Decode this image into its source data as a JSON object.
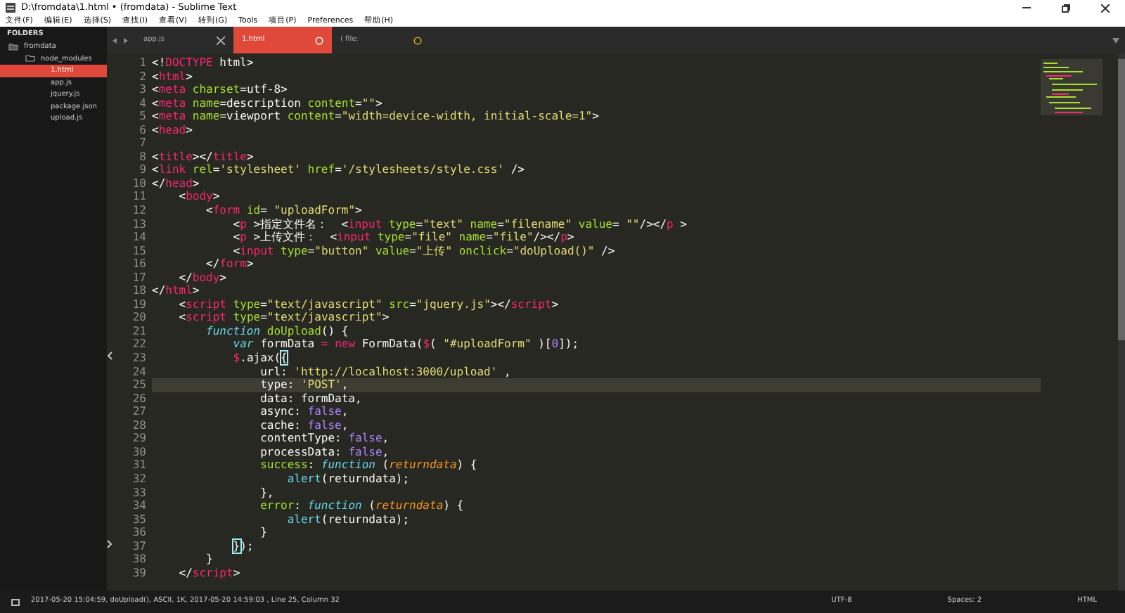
{
  "window": {
    "title": "D:\\fromdata\\1.html • (fromdata) - Sublime Text"
  },
  "menu": [
    "文件(F)",
    "编辑(E)",
    "选择(S)",
    "查找(I)",
    "查看(V)",
    "转到(G)",
    "Tools",
    "项目(P)",
    "Preferences",
    "帮助(H)"
  ],
  "sidebar": {
    "header": "FOLDERS",
    "items": [
      {
        "label": "fromdata",
        "kind": "folder",
        "expanded": true,
        "selected": false,
        "children": [
          {
            "label": "node_modules",
            "kind": "folder",
            "expanded": false,
            "selected": false
          },
          {
            "label": "1.html",
            "kind": "file",
            "selected": true
          },
          {
            "label": "app.js",
            "kind": "file",
            "selected": false
          },
          {
            "label": "jquery.js",
            "kind": "file",
            "selected": false
          },
          {
            "label": "package.json",
            "kind": "file",
            "selected": false
          },
          {
            "label": "upload.js",
            "kind": "file",
            "selected": false
          }
        ]
      }
    ]
  },
  "tabs": [
    {
      "label": "app.js",
      "selected": false,
      "dirty": false
    },
    {
      "label": "1.html",
      "selected": true,
      "dirty": true
    },
    {
      "label": "( file:",
      "selected": false,
      "dirty": true
    }
  ],
  "editor": {
    "lines": [
      {
        "number": "1",
        "tokens": [
          {
            "kind": "plain",
            "text": "<!"
          },
          {
            "kind": "tag",
            "text": "DOCTYPE"
          },
          {
            "kind": "plain",
            "text": " html>"
          }
        ]
      },
      {
        "number": "2",
        "tokens": [
          {
            "kind": "plain",
            "text": "<"
          },
          {
            "kind": "tag",
            "text": "html"
          },
          {
            "kind": "plain",
            "text": ">"
          }
        ]
      },
      {
        "number": "3",
        "tokens": [
          {
            "kind": "plain",
            "text": "<"
          },
          {
            "kind": "tag",
            "text": "meta"
          },
          {
            "kind": "attr",
            "text": " charset"
          },
          {
            "kind": "plain",
            "text": "=utf-8>"
          }
        ]
      },
      {
        "number": "4",
        "tokens": [
          {
            "kind": "plain",
            "text": "<"
          },
          {
            "kind": "tag",
            "text": "meta"
          },
          {
            "kind": "attr",
            "text": " name"
          },
          {
            "kind": "plain",
            "text": "=description"
          },
          {
            "kind": "attr",
            "text": " content"
          },
          {
            "kind": "plain",
            "text": "="
          },
          {
            "kind": "string",
            "text": "\"\""
          },
          {
            "kind": "plain",
            "text": ">"
          }
        ]
      },
      {
        "number": "5",
        "tokens": [
          {
            "kind": "plain",
            "text": "<"
          },
          {
            "kind": "tag",
            "text": "meta"
          },
          {
            "kind": "attr",
            "text": " name"
          },
          {
            "kind": "plain",
            "text": "=viewport"
          },
          {
            "kind": "attr",
            "text": " content"
          },
          {
            "kind": "plain",
            "text": "="
          },
          {
            "kind": "string",
            "text": "\"width=device-width, initial-scale=1\""
          },
          {
            "kind": "plain",
            "text": ">"
          }
        ]
      },
      {
        "number": "6",
        "tokens": [
          {
            "kind": "plain",
            "text": "<"
          },
          {
            "kind": "tag",
            "text": "head"
          },
          {
            "kind": "plain",
            "text": ">"
          }
        ]
      },
      {
        "number": "7"
      },
      {
        "number": "8",
        "tokens": [
          {
            "kind": "plain",
            "text": "<"
          },
          {
            "kind": "tag",
            "text": "title"
          },
          {
            "kind": "plain",
            "text": "></"
          },
          {
            "kind": "tag",
            "text": "title"
          },
          {
            "kind": "plain",
            "text": ">"
          }
        ]
      },
      {
        "number": "9",
        "tokens": [
          {
            "kind": "plain",
            "text": "<"
          },
          {
            "kind": "tag",
            "text": "link"
          },
          {
            "kind": "attr",
            "text": " rel"
          },
          {
            "kind": "plain",
            "text": "="
          },
          {
            "kind": "string",
            "text": "'stylesheet'"
          },
          {
            "kind": "attr",
            "text": " href"
          },
          {
            "kind": "plain",
            "text": "="
          },
          {
            "kind": "string",
            "text": "'/stylesheets/style.css'"
          },
          {
            "kind": "plain",
            "text": " />"
          }
        ]
      },
      {
        "number": "10",
        "tokens": [
          {
            "kind": "plain",
            "text": "</"
          },
          {
            "kind": "tag",
            "text": "head"
          },
          {
            "kind": "plain",
            "text": ">"
          }
        ]
      },
      {
        "number": "11",
        "tokens": [
          {
            "kind": "plain",
            "text": "    <"
          },
          {
            "kind": "tag",
            "text": "body"
          },
          {
            "kind": "plain",
            "text": ">"
          }
        ]
      },
      {
        "number": "12",
        "tokens": [
          {
            "kind": "plain",
            "text": "        <"
          },
          {
            "kind": "tag",
            "text": "form"
          },
          {
            "kind": "attr",
            "text": " id"
          },
          {
            "kind": "plain",
            "text": "= "
          },
          {
            "kind": "string",
            "text": "\"uploadForm\""
          },
          {
            "kind": "plain",
            "text": ">"
          }
        ]
      },
      {
        "number": "13",
        "tokens": [
          {
            "kind": "plain",
            "text": "            <"
          },
          {
            "kind": "tag",
            "text": "p"
          },
          {
            "kind": "plain",
            "text": " >指定文件名：  <"
          },
          {
            "kind": "tag",
            "text": "input"
          },
          {
            "kind": "attr",
            "text": " type"
          },
          {
            "kind": "plain",
            "text": "="
          },
          {
            "kind": "string",
            "text": "\"text\""
          },
          {
            "kind": "attr",
            "text": " name"
          },
          {
            "kind": "plain",
            "text": "="
          },
          {
            "kind": "string",
            "text": "\"filename\""
          },
          {
            "kind": "attr",
            "text": " value"
          },
          {
            "kind": "plain",
            "text": "= "
          },
          {
            "kind": "string",
            "text": "\"\""
          },
          {
            "kind": "plain",
            "text": "/></"
          },
          {
            "kind": "tag",
            "text": "p"
          },
          {
            "kind": "plain",
            "text": " >"
          }
        ]
      },
      {
        "number": "14",
        "tokens": [
          {
            "kind": "plain",
            "text": "            <"
          },
          {
            "kind": "tag",
            "text": "p"
          },
          {
            "kind": "plain",
            "text": " >上传文件：  <"
          },
          {
            "kind": "tag",
            "text": "input"
          },
          {
            "kind": "attr",
            "text": " type"
          },
          {
            "kind": "plain",
            "text": "="
          },
          {
            "kind": "string",
            "text": "\"file\""
          },
          {
            "kind": "attr",
            "text": " name"
          },
          {
            "kind": "plain",
            "text": "="
          },
          {
            "kind": "string",
            "text": "\"file\""
          },
          {
            "kind": "plain",
            "text": "/></"
          },
          {
            "kind": "tag",
            "text": "p"
          },
          {
            "kind": "plain",
            "text": ">"
          }
        ]
      },
      {
        "number": "15",
        "tokens": [
          {
            "kind": "plain",
            "text": "            <"
          },
          {
            "kind": "tag",
            "text": "input"
          },
          {
            "kind": "attr",
            "text": " type"
          },
          {
            "kind": "plain",
            "text": "="
          },
          {
            "kind": "string",
            "text": "\"button\""
          },
          {
            "kind": "attr",
            "text": " value"
          },
          {
            "kind": "plain",
            "text": "="
          },
          {
            "kind": "string",
            "text": "\"上传\""
          },
          {
            "kind": "attr",
            "text": " onclick"
          },
          {
            "kind": "plain",
            "text": "="
          },
          {
            "kind": "string",
            "text": "\"doUpload()\""
          },
          {
            "kind": "plain",
            "text": " />"
          }
        ]
      },
      {
        "number": "16",
        "tokens": [
          {
            "kind": "plain",
            "text": "        </"
          },
          {
            "kind": "tag",
            "text": "form"
          },
          {
            "kind": "plain",
            "text": ">"
          }
        ]
      },
      {
        "number": "17",
        "tokens": [
          {
            "kind": "plain",
            "text": "    </"
          },
          {
            "kind": "tag",
            "text": "body"
          },
          {
            "kind": "plain",
            "text": ">"
          }
        ]
      },
      {
        "number": "18",
        "tokens": [
          {
            "kind": "plain",
            "text": "</"
          },
          {
            "kind": "tag",
            "text": "html"
          },
          {
            "kind": "plain",
            "text": ">"
          }
        ]
      },
      {
        "number": "19",
        "tokens": [
          {
            "kind": "plain",
            "text": "    <"
          },
          {
            "kind": "tag",
            "text": "script"
          },
          {
            "kind": "attr",
            "text": " type"
          },
          {
            "kind": "plain",
            "text": "="
          },
          {
            "kind": "string",
            "text": "\"text/javascript\""
          },
          {
            "kind": "attr",
            "text": " src"
          },
          {
            "kind": "plain",
            "text": "="
          },
          {
            "kind": "string",
            "text": "\"jquery.js\""
          },
          {
            "kind": "plain",
            "text": "></"
          },
          {
            "kind": "tag",
            "text": "script"
          },
          {
            "kind": "plain",
            "text": ">"
          }
        ]
      },
      {
        "number": "20",
        "tokens": [
          {
            "kind": "plain",
            "text": "    <"
          },
          {
            "kind": "tag",
            "text": "script"
          },
          {
            "kind": "attr",
            "text": " type"
          },
          {
            "kind": "plain",
            "text": "="
          },
          {
            "kind": "string",
            "text": "\"text/javascript\""
          },
          {
            "kind": "plain",
            "text": ">"
          }
        ]
      },
      {
        "number": "21",
        "tokens": [
          {
            "kind": "keyword",
            "text": "        function"
          },
          {
            "kind": "function",
            "text": " doUpload"
          },
          {
            "kind": "plain",
            "text": "() {"
          }
        ]
      },
      {
        "number": "22",
        "tokens": [
          {
            "kind": "keyword",
            "text": "            var"
          },
          {
            "kind": "plain",
            "text": " formData "
          },
          {
            "kind": "operator",
            "text": "="
          },
          {
            "kind": "operator",
            "text": " new"
          },
          {
            "kind": "plain",
            "text": " FormData("
          },
          {
            "kind": "operator",
            "text": "$"
          },
          {
            "kind": "plain",
            "text": "( "
          },
          {
            "kind": "string",
            "text": "\"#uploadForm\""
          },
          {
            "kind": "plain",
            "text": " )["
          },
          {
            "kind": "constant",
            "text": "0"
          },
          {
            "kind": "plain",
            "text": "]);"
          }
        ]
      },
      {
        "number": "23",
        "fold_start": true,
        "tokens": [
          {
            "kind": "operator",
            "text": "            $"
          },
          {
            "kind": "plain",
            "text": ".ajax("
          },
          {
            "kind": "bracket",
            "text": "{"
          }
        ]
      },
      {
        "number": "24",
        "tokens": [
          {
            "kind": "plain",
            "text": "                url: "
          },
          {
            "kind": "string",
            "text": "'http://localhost:3000/upload'"
          },
          {
            "kind": "plain",
            "text": " ,"
          }
        ]
      },
      {
        "number": "25",
        "current": true,
        "tokens": [
          {
            "kind": "plain",
            "text": "                type: "
          },
          {
            "kind": "string",
            "text": "'POST'"
          },
          {
            "kind": "plain",
            "text": ","
          }
        ]
      },
      {
        "number": "26",
        "tokens": [
          {
            "kind": "plain",
            "text": "                data: formData,"
          }
        ]
      },
      {
        "number": "27",
        "tokens": [
          {
            "kind": "plain",
            "text": "                async: "
          },
          {
            "kind": "constant",
            "text": "false"
          },
          {
            "kind": "plain",
            "text": ","
          }
        ]
      },
      {
        "number": "28",
        "tokens": [
          {
            "kind": "plain",
            "text": "                cache: "
          },
          {
            "kind": "constant",
            "text": "false"
          },
          {
            "kind": "plain",
            "text": ","
          }
        ]
      },
      {
        "number": "29",
        "tokens": [
          {
            "kind": "plain",
            "text": "                contentType: "
          },
          {
            "kind": "constant",
            "text": "false"
          },
          {
            "kind": "plain",
            "text": ","
          }
        ]
      },
      {
        "number": "30",
        "tokens": [
          {
            "kind": "plain",
            "text": "                processData: "
          },
          {
            "kind": "constant",
            "text": "false"
          },
          {
            "kind": "plain",
            "text": ","
          }
        ]
      },
      {
        "number": "31",
        "tokens": [
          {
            "kind": "function",
            "text": "                success"
          },
          {
            "kind": "plain",
            "text": ": "
          },
          {
            "kind": "keyword",
            "text": "function"
          },
          {
            "kind": "plain",
            "text": " ("
          },
          {
            "kind": "param",
            "text": "returndata"
          },
          {
            "kind": "plain",
            "text": ") {"
          }
        ]
      },
      {
        "number": "32",
        "tokens": [
          {
            "kind": "builtin",
            "text": "                    alert"
          },
          {
            "kind": "plain",
            "text": "(returndata);"
          }
        ]
      },
      {
        "number": "33",
        "tokens": [
          {
            "kind": "plain",
            "text": "                },"
          }
        ]
      },
      {
        "number": "34",
        "tokens": [
          {
            "kind": "function",
            "text": "                error"
          },
          {
            "kind": "plain",
            "text": ": "
          },
          {
            "kind": "keyword",
            "text": "function"
          },
          {
            "kind": "plain",
            "text": " ("
          },
          {
            "kind": "param",
            "text": "returndata"
          },
          {
            "kind": "plain",
            "text": ") {"
          }
        ]
      },
      {
        "number": "35",
        "tokens": [
          {
            "kind": "builtin",
            "text": "                    alert"
          },
          {
            "kind": "plain",
            "text": "(returndata);"
          }
        ]
      },
      {
        "number": "36",
        "tokens": [
          {
            "kind": "plain",
            "text": "                }"
          }
        ]
      },
      {
        "number": "37",
        "fold_end": true,
        "tokens": [
          {
            "kind": "bracket",
            "text": "            }"
          },
          {
            "kind": "plain",
            "text": ");"
          }
        ]
      },
      {
        "number": "38",
        "tokens": [
          {
            "kind": "plain",
            "text": "        }"
          }
        ]
      },
      {
        "number": "39",
        "tokens": [
          {
            "kind": "plain",
            "text": "    </"
          },
          {
            "kind": "tag",
            "text": "script"
          },
          {
            "kind": "plain",
            "text": ">"
          }
        ]
      }
    ]
  },
  "status_bar": {
    "message": "2017-05-20 15:04:59, doUpload(), ASCII, 1K, 2017-05-20 14:59:03 , Line 25, Column 32",
    "encoding": "UTF-8",
    "indentation": "Spaces: 2",
    "syntax": "HTML"
  }
}
